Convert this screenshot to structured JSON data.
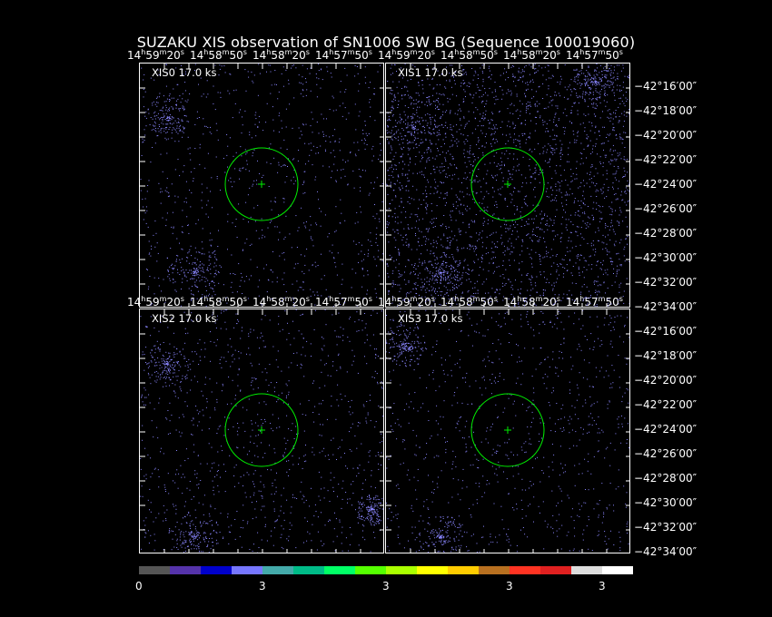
{
  "title": "SUZAKU XIS observation of SN1006 SW BG  (Sequence 100019060)",
  "ra_top_labels": [
    "14h59m20s",
    "14h58m50s",
    "14h58m20s",
    "14h57m50s"
  ],
  "ra_mid_labels": [
    "14h59m20s",
    "14h58m50s",
    "14h58m20s",
    "14h57m50s"
  ],
  "ra_right_labels": [
    "14h59m20s",
    "14h58m50s",
    "14h58m20s",
    "14h57m50s"
  ],
  "panels": [
    {
      "label": "XIS0  17.0  ks"
    },
    {
      "label": "XIS1  17.0  ks"
    },
    {
      "label": "XIS2  17.0  ks"
    },
    {
      "label": "XIS3  17.0  ks"
    }
  ],
  "dec_labels_top": [
    "−42°16′00″",
    "−42°18′00″",
    "−42°20′00″",
    "−42°22′00″",
    "−42°24′00″",
    "−42°26′00″",
    "−42°28′00″",
    "−42°30′00″",
    "−42°32′00″",
    "−42°34′00″"
  ],
  "dec_labels_bottom": [
    "−42°16′00″",
    "−42°18′00″",
    "−42°20′00″",
    "−42°22′00″",
    "−42°24′00″",
    "−42°26′00″",
    "−42°28′00″",
    "−42°30′00″",
    "−42°32′00″",
    "−42°34′00″"
  ],
  "colorbar": {
    "colors": [
      "#555555",
      "#5533aa",
      "#0000cc",
      "#7777ff",
      "#44aaaa",
      "#00bb88",
      "#00ff66",
      "#55ff00",
      "#aaff00",
      "#ffff00",
      "#ffcc00",
      "#b87020",
      "#ff3322",
      "#e02020",
      "#dddddd",
      "#ffffff"
    ],
    "tick_labels": [
      "0",
      "3",
      "3",
      "3",
      "3"
    ]
  },
  "colors": {
    "circle": "#00ee00",
    "noise": "#8a86ff",
    "background": "#000000"
  }
}
